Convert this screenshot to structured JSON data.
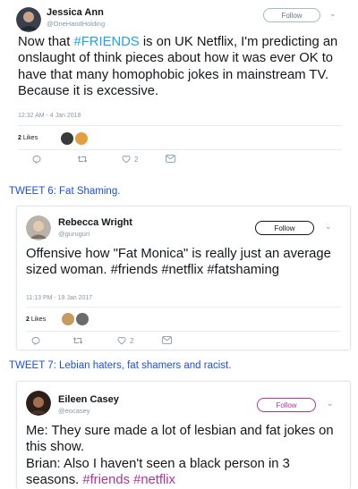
{
  "tweets": [
    {
      "name": "Jessica Ann",
      "handle": "@OneHandHolding",
      "follow_label": "Follow",
      "text_before": "Now that ",
      "text_hashtag": "#FRIENDS",
      "text_after": " is on UK Netflix, I'm predicting an onslaught of think pieces about how it was ever OK to have that many homophobic jokes in mainstream TV. Because it is excessive.",
      "timestamp": "12:32 AM - 4 Jan 2018",
      "likes_count": "2",
      "likes_label": "Likes",
      "reply_count": "",
      "retweet_count": "",
      "like_count": "2"
    },
    {
      "name": "Rebecca Wright",
      "handle": "@guruguri",
      "follow_label": "Follow",
      "text": "Offensive how \"Fat Monica\" is really just an average sized woman. #friends #netflix #fatshaming",
      "timestamp": "11:13 PM - 19 Jan 2017",
      "likes_count": "2",
      "likes_label": "Likes",
      "reply_count": "",
      "retweet_count": "",
      "like_count": "2"
    },
    {
      "name": "Eileen Casey",
      "handle": "@eocasey",
      "follow_label": "Follow",
      "text_line1": "Me: They sure made a lot of lesbian and fat jokes on this show.",
      "text_line2": "Brian: Also I haven't seen a black person in 3 seasons. ",
      "text_hashtags": "#friends #netflix"
    }
  ],
  "labels": {
    "tweet6": "TWEET 6: Fat Shaming.",
    "tweet7": "TWEET 7: Lebian haters, fat shamers and racist."
  },
  "icons": {
    "reply": "reply-icon",
    "retweet": "retweet-icon",
    "like": "heart-icon",
    "dm": "direct-message-icon",
    "more": "chevron-down-icon"
  },
  "colors": {
    "hashtag_blue": "#1da1f2",
    "hashtag_pink": "#b0359c",
    "label_blue": "#1d4ed8",
    "secondary_text": "#8899a6"
  }
}
